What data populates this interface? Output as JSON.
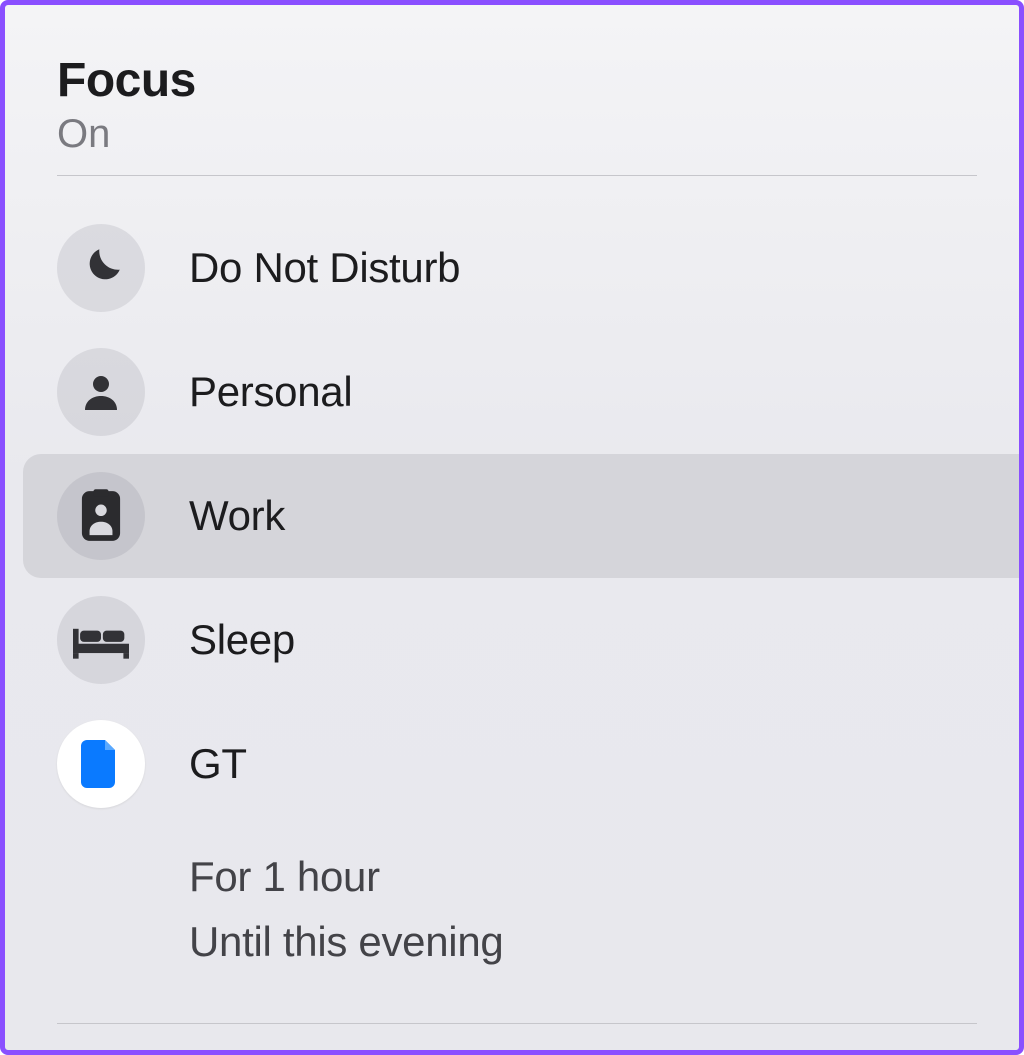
{
  "header": {
    "title": "Focus",
    "status": "On"
  },
  "modes": [
    {
      "id": "dnd",
      "label": "Do Not Disturb",
      "icon": "moon-icon",
      "selected": false,
      "active": false
    },
    {
      "id": "personal",
      "label": "Personal",
      "icon": "person-icon",
      "selected": false,
      "active": false
    },
    {
      "id": "work",
      "label": "Work",
      "icon": "badge-icon",
      "selected": true,
      "active": false
    },
    {
      "id": "sleep",
      "label": "Sleep",
      "icon": "bed-icon",
      "selected": false,
      "active": false
    },
    {
      "id": "gt",
      "label": "GT",
      "icon": "document-icon",
      "selected": false,
      "active": true
    }
  ],
  "durations": [
    "For 1 hour",
    "Until this evening"
  ],
  "colors": {
    "accent_blue": "#0a7aff",
    "icon_dark": "#323236",
    "frame_border": "#8a4fff"
  }
}
